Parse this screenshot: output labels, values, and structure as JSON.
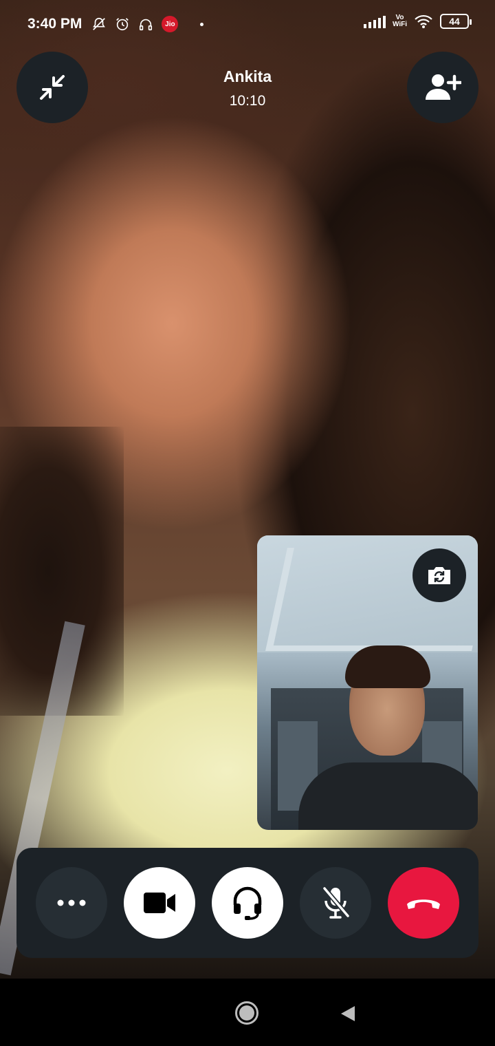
{
  "status_bar": {
    "time": "3:40 PM",
    "carrier_badge": "Jio",
    "network_label_top": "Vo",
    "network_label_bottom": "WiFi",
    "battery": "44",
    "icons": [
      "mute-notifications-icon",
      "alarm-icon",
      "headphones-icon",
      "jio-icon",
      "signal-icon",
      "wifi-icon",
      "battery-icon"
    ]
  },
  "call": {
    "caller_name": "Ankita",
    "duration": "10:10"
  },
  "top_controls": {
    "minimize_icon": "minimize-arrows-icon",
    "add_person_icon": "add-person-icon"
  },
  "self_preview": {
    "flip_camera_icon": "flip-camera-icon"
  },
  "controls": [
    {
      "name": "more-options-button",
      "icon": "more-dots-icon",
      "style": "dark"
    },
    {
      "name": "video-toggle-button",
      "icon": "video-camera-icon",
      "style": "white"
    },
    {
      "name": "audio-output-button",
      "icon": "headset-icon",
      "style": "white"
    },
    {
      "name": "mute-mic-button",
      "icon": "microphone-off-icon",
      "style": "dark"
    },
    {
      "name": "end-call-button",
      "icon": "hang-up-icon",
      "style": "red"
    }
  ],
  "colors": {
    "panel": "#1c2227",
    "button_dark": "#262e34",
    "end_call": "#e8173f",
    "jio": "#d6192b"
  },
  "nav_bar": {
    "home_icon": "home-circle-icon",
    "back_icon": "back-triangle-icon"
  }
}
